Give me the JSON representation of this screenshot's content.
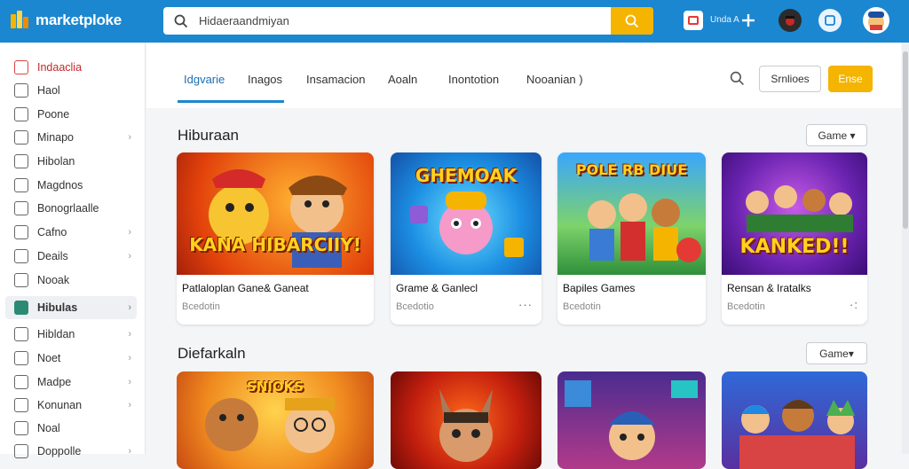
{
  "app": {
    "logo_text": "marketploke"
  },
  "search": {
    "value": "Hidaeraandmiyan"
  },
  "topbar": {
    "label": "Unda A"
  },
  "sidebar": {
    "items": [
      {
        "label": "Indaaclia"
      },
      {
        "label": "Haol"
      },
      {
        "label": "Poone"
      },
      {
        "label": "Minapo"
      },
      {
        "label": "Hibolan"
      },
      {
        "label": "Magdnos"
      },
      {
        "label": "Bonogrlaalle"
      },
      {
        "label": "Cafno"
      },
      {
        "label": "Deails"
      },
      {
        "label": "Nooak"
      },
      {
        "label": "Hibulas"
      },
      {
        "label": "Hibldan"
      },
      {
        "label": "Noet"
      },
      {
        "label": "Madpe"
      },
      {
        "label": "Konunan"
      },
      {
        "label": "Noal"
      },
      {
        "label": "Doppolle"
      }
    ]
  },
  "tabs": [
    {
      "label": "Idgvarie"
    },
    {
      "label": "Inagos"
    },
    {
      "label": "Insamacion"
    },
    {
      "label": "Aoaln"
    },
    {
      "label": "Inontotion"
    },
    {
      "label": "Nooanian )"
    }
  ],
  "header_buttons": {
    "outline": "Srnlioes",
    "primary": "Ense"
  },
  "sections": [
    {
      "title": "Hiburaan",
      "dropdown": "Game ▾",
      "cards": [
        {
          "title": "Patlaloplan Gane& Ganeat",
          "sub": "Bcedotin",
          "thumb_text": "KANA HIBARCIIY!"
        },
        {
          "title": "Grame & Ganlecl",
          "sub": "Bcedotio",
          "thumb_text": "GHEMOAK"
        },
        {
          "title": "Bapiles Games",
          "sub": "Bcedotin",
          "thumb_text": "POLE RB DIUE"
        },
        {
          "title": "Rensan & Iratalks",
          "sub": "Bcedotin",
          "thumb_text": "KANKED!!"
        }
      ]
    },
    {
      "title": "Diefarkaln",
      "dropdown": "Game▾",
      "cards": [
        {
          "thumb_text": "SNIOKS"
        },
        {
          "thumb_text": ""
        },
        {
          "thumb_text": ""
        },
        {
          "thumb_text": ""
        }
      ]
    }
  ],
  "colors": {
    "topbar": "#1b87d0",
    "accent": "#f4b400",
    "active_tab": "#1b6fb6"
  }
}
